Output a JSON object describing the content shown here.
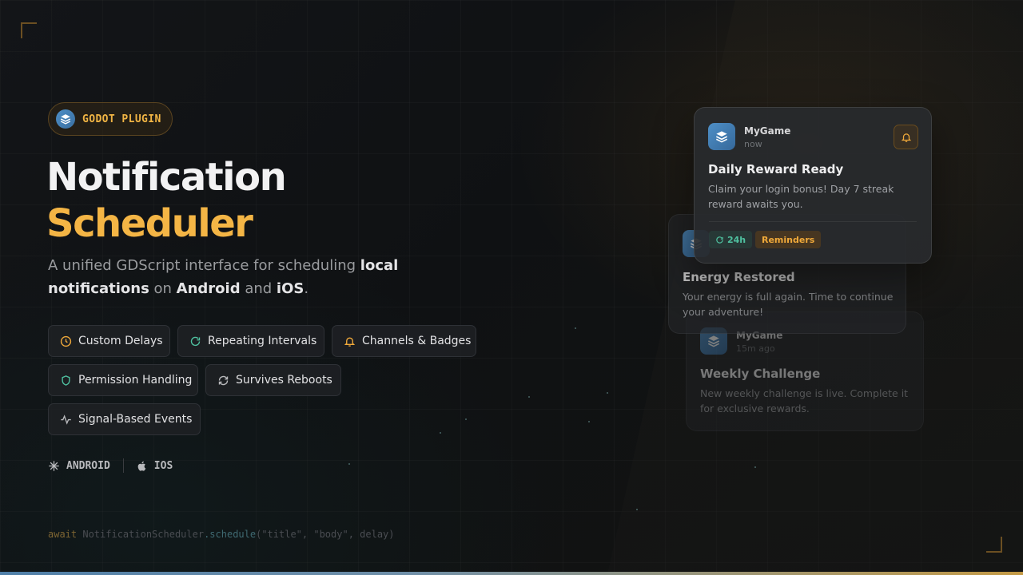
{
  "badge": {
    "label": "GODOT PLUGIN"
  },
  "hero": {
    "title_line1": "Notification",
    "title_line2": "Scheduler",
    "subtitle": {
      "part1": "A unified GDScript interface for scheduling ",
      "bold1": "local notifications",
      "part2": " on ",
      "bold2": "Android",
      "part3": " and ",
      "bold3": "iOS",
      "part4": "."
    }
  },
  "features": [
    {
      "label": "Custom Delays",
      "icon": "clock-icon"
    },
    {
      "label": "Repeating Intervals",
      "icon": "repeat-icon"
    },
    {
      "label": "Channels & Badges",
      "icon": "bell-icon"
    },
    {
      "label": "Permission Handling",
      "icon": "shield-icon"
    },
    {
      "label": "Survives Reboots",
      "icon": "refresh-icon"
    },
    {
      "label": "Signal-Based Events",
      "icon": "activity-icon"
    }
  ],
  "platforms": [
    {
      "label": "ANDROID",
      "icon": "android-icon"
    },
    {
      "label": "IOS",
      "icon": "apple-icon"
    }
  ],
  "code_snippet": {
    "keyword": "await",
    "class_name": "NotificationScheduler",
    "method": ".schedule",
    "args": "(\"title\", \"body\", delay)"
  },
  "notifications": [
    {
      "app": "MyGame",
      "time": "now",
      "title": "Daily Reward Ready",
      "body": "Claim your login bonus! Day 7 streak reward awaits you.",
      "tags": [
        {
          "label": "24h",
          "icon": "repeat-icon",
          "color": "#4fc1a0"
        },
        {
          "label": "Reminders",
          "color": "#f0a93a"
        }
      ]
    },
    {
      "title": "Energy Restored",
      "body": "Your energy is full again. Time to continue your adventure!"
    },
    {
      "app": "MyGame",
      "time": "15m ago",
      "title": "Weekly Challenge",
      "body": "New weekly challenge is live. Complete it for exclusive rewards."
    }
  ],
  "colors": {
    "accent": "#f4b545",
    "brand_blue": "#4e8fc7",
    "background": "#121416",
    "success": "#4fc1a0"
  }
}
